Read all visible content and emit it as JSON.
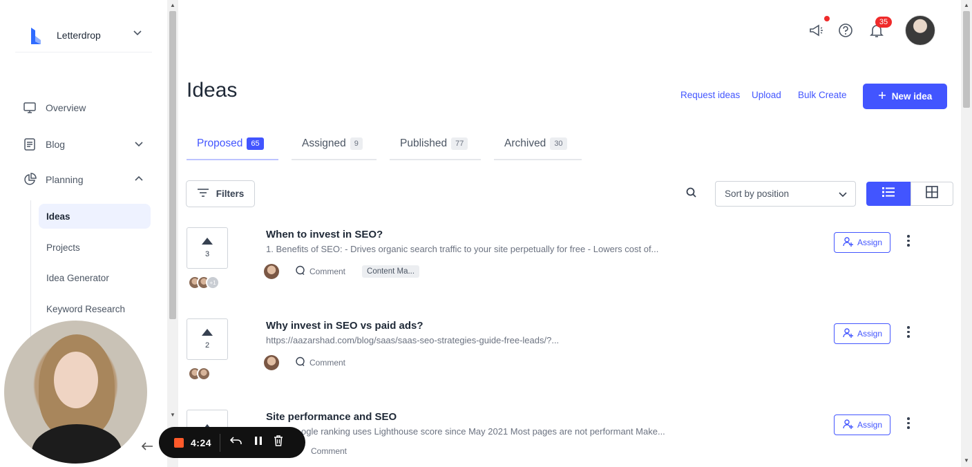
{
  "brand": {
    "name": "Letterdrop",
    "logo_color": "#2f6bff"
  },
  "sidebar": {
    "items": [
      {
        "label": "Overview",
        "icon": "monitor-icon"
      },
      {
        "label": "Blog",
        "icon": "document-icon"
      },
      {
        "label": "Planning",
        "icon": "pie-chart-icon"
      }
    ],
    "planning_items": [
      "Ideas",
      "Projects",
      "Idea Generator",
      "Keyword Research"
    ],
    "active": "Ideas"
  },
  "topbar": {
    "notification_count": "35"
  },
  "page": {
    "title": "Ideas"
  },
  "actions": {
    "request_ideas": "Request ideas",
    "upload": "Upload",
    "bulk_create": "Bulk Create",
    "new_idea": "New idea"
  },
  "tabs": [
    {
      "label": "Proposed",
      "count": "65"
    },
    {
      "label": "Assigned",
      "count": "9"
    },
    {
      "label": "Published",
      "count": "77"
    },
    {
      "label": "Archived",
      "count": "30"
    }
  ],
  "toolbar": {
    "filters": "Filters",
    "sort": "Sort by position"
  },
  "ideas": [
    {
      "votes": "3",
      "voter_extra": "+1",
      "title": "When to invest in SEO?",
      "desc": "1. Benefits of SEO: - Drives organic search traffic to your site perpetually for free - Lowers cost of...",
      "comment": "Comment",
      "tag": "Content Ma...",
      "assign": "Assign"
    },
    {
      "votes": "2",
      "title": "Why invest in SEO vs paid ads?",
      "desc": "https://aazarshad.com/blog/saas/saas-seo-strategies-guide-free-leads/?...",
      "comment": "Comment",
      "assign": "Assign"
    },
    {
      "votes": "",
      "title": "Site performance and SEO",
      "desc": "ogle ranking uses Lighthouse score since May 2021 Most pages are not performant Make...",
      "comment": "Comment",
      "assign": "Assign"
    }
  ],
  "recorder": {
    "time": "4:24"
  },
  "colors": {
    "accent": "#4255ff",
    "danger": "#ef2a2a",
    "record": "#ff5a2a"
  }
}
